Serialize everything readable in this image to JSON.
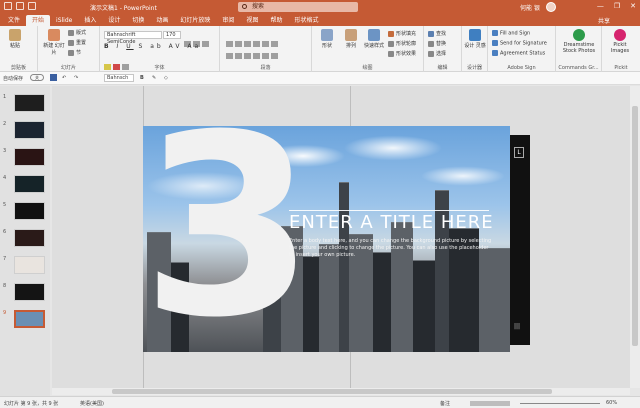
{
  "titlebar": {
    "doc_title": "演示文稿1 - PowerPoint",
    "search_placeholder": "搜索",
    "user_name": "何能 银",
    "minimize": "—",
    "restore": "❐",
    "close": "✕"
  },
  "tabs": [
    "文件",
    "开始",
    "iSlide",
    "插入",
    "设计",
    "切换",
    "动画",
    "幻灯片放映",
    "审阅",
    "视图",
    "帮助",
    "形状格式"
  ],
  "active_tab": "开始",
  "share_label": "共享",
  "ribbon": {
    "clipboard": {
      "paste": "粘贴",
      "label": "剪贴板"
    },
    "slides": {
      "new_slide": "新建\n幻灯片",
      "layout": "版式",
      "reset": "重置",
      "section": "节",
      "label": "幻灯片"
    },
    "font": {
      "font_name": "Bahnschrift SemiConde",
      "font_size": "170",
      "label": "字体"
    },
    "paragraph": {
      "label": "段落"
    },
    "drawing": {
      "shapes": "形状",
      "arrange": "排列",
      "quick_styles": "快速样式",
      "fill": "形状填充",
      "outline": "形状轮廓",
      "effects": "形状效果",
      "label": "绘图"
    },
    "editing": {
      "find": "查找",
      "replace": "替换",
      "select": "选择",
      "label": "编辑"
    },
    "designer": {
      "idea": "设计\n灵感",
      "label": "设计器"
    },
    "adobe": {
      "fill_sign": "Fill and Sign",
      "send_sig": "Send for Signature",
      "agreement": "Agreement Status",
      "label": "Adobe Sign"
    },
    "commands": {
      "dreamstime": "Dreamstime\nStock Photos",
      "label": "Commands Gr..."
    },
    "pickit": {
      "images": "Pickit\nImages",
      "label": "Pickit"
    }
  },
  "qat2": {
    "autosave": "自动保存",
    "off": "关",
    "font_mini": "Bahnsch"
  },
  "thumbnails": [
    {
      "num": "1",
      "color": "#1e1e1e"
    },
    {
      "num": "2",
      "color": "#1b2430"
    },
    {
      "num": "3",
      "color": "#2a1414"
    },
    {
      "num": "4",
      "color": "#152328"
    },
    {
      "num": "5",
      "color": "#111111"
    },
    {
      "num": "6",
      "color": "#2a1a18"
    },
    {
      "num": "7",
      "color": "#e9e4df"
    },
    {
      "num": "8",
      "color": "#141414"
    },
    {
      "num": "9",
      "color": "#6a8fb3"
    }
  ],
  "slide": {
    "big_number": "3",
    "title": "ENTER A TITLE HERE",
    "body": "Enter a body text here, and you can change the background picture by selecting the picture and clicking to change the picture. You can also use the placeholder to insert your own picture.",
    "side_mark": "L",
    "side_bars": "|||"
  },
  "status": {
    "slide_info": "幻灯片 第 9 张，共 9 张",
    "language": "英语(美国)",
    "notes": "备注",
    "zoom": "60%"
  }
}
